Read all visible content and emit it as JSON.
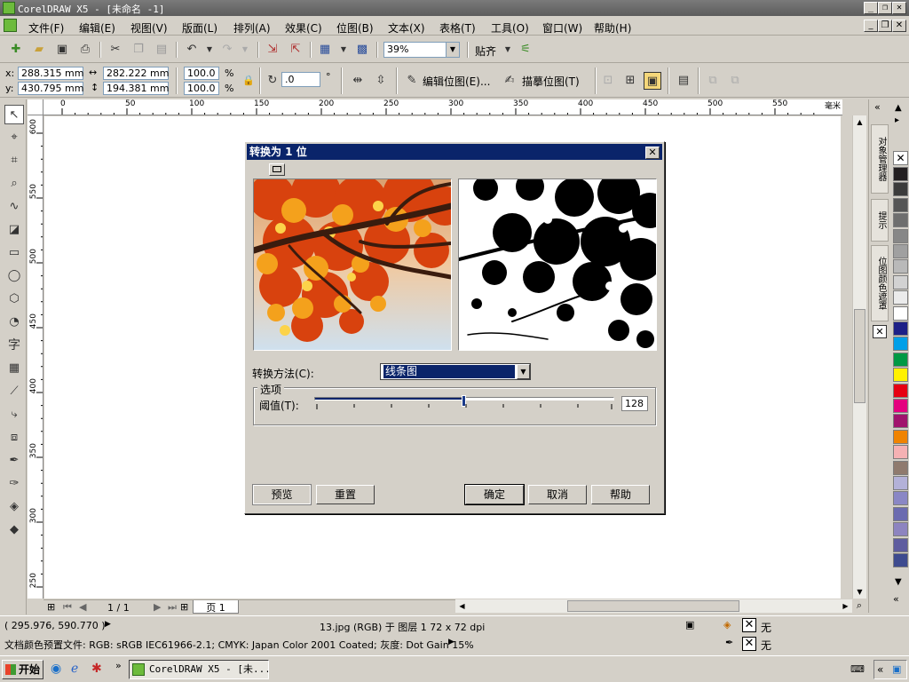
{
  "window": {
    "title": "CorelDRAW X5 - [未命名 -1]",
    "minimize": "_",
    "restore": "❐",
    "close": "✕"
  },
  "menu": [
    "文件(F)",
    "编辑(E)",
    "视图(V)",
    "版面(L)",
    "排列(A)",
    "效果(C)",
    "位图(B)",
    "文本(X)",
    "表格(T)",
    "工具(O)",
    "窗口(W)",
    "帮助(H)"
  ],
  "toolbar": {
    "zoom": "39%",
    "snap": "贴齐"
  },
  "propbar": {
    "x_label": "x:",
    "x_value": "288.315 mm",
    "y_label": "y:",
    "y_value": "430.795 mm",
    "w_value": "282.222 mm",
    "h_value": "194.381 mm",
    "scale_x": "100.0",
    "scale_y": "100.0",
    "pct": "%",
    "rotation": ".0",
    "degree": "°",
    "edit_bitmap": "编辑位图(E)...",
    "trace_bitmap": "描摹位图(T)"
  },
  "ruler": {
    "unit": "毫米",
    "h_ticks": [
      "0",
      "50",
      "100",
      "150",
      "200",
      "250",
      "300",
      "350",
      "400",
      "450",
      "500",
      "550"
    ],
    "v_ticks": [
      "600",
      "550",
      "500",
      "450",
      "400",
      "350",
      "300",
      "250"
    ]
  },
  "dockers": {
    "object_manager": "对象管理器",
    "hints": "提示",
    "bitmap_color_mask": "位图颜色遮罩"
  },
  "palette_colors": [
    "#231f20",
    "#3b3b3b",
    "#555555",
    "#6e6e6e",
    "#878787",
    "#a0a0a0",
    "#b9b9b9",
    "#d2d2d2",
    "#ebebeb",
    "#ffffff",
    "#1d2087",
    "#009fe8",
    "#009944",
    "#fff100",
    "#e60012",
    "#e4007f",
    "#a0136d",
    "#f08300",
    "#f5b1b3",
    "#8f7a6e",
    "#b3b1d8",
    "#8a87c5",
    "#6b6bb0",
    "#8d84c0",
    "#5e5c9f",
    "#3e4b8f"
  ],
  "pagenav": {
    "pages": "1 / 1",
    "page_tab": "页 1"
  },
  "status": {
    "coords": "( 295.976, 590.770 )",
    "object_info": "13.jpg (RGB) 于 图层 1 72 x 72 dpi",
    "color_profile": "文档颜色预置文件: RGB: sRGB IEC61966-2.1; CMYK: Japan Color 2001 Coated; 灰度: Dot Gain 15%",
    "fill_none": "无",
    "outline_none": "无"
  },
  "taskbar": {
    "start": "开始",
    "task": "CorelDRAW X5 - [未..."
  },
  "dialog": {
    "title": "转换为 1 位",
    "method_label": "转换方法(C):",
    "method_value": "线条图",
    "options_group": "选项",
    "threshold_label": "阈值(T):",
    "threshold_value": "128",
    "threshold_fraction": 0.5,
    "btn_preview": "预览",
    "btn_reset": "重置",
    "btn_ok": "确定",
    "btn_cancel": "取消",
    "btn_help": "帮助"
  }
}
